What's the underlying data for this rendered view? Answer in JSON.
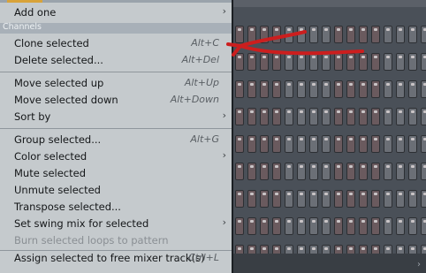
{
  "menu": {
    "add_one": "Add one",
    "channels_header": "Channels",
    "clone": {
      "label": "Clone selected",
      "shortcut": "Alt+C"
    },
    "delete": {
      "label": "Delete selected...",
      "shortcut": "Alt+Del"
    },
    "move_up": {
      "label": "Move selected up",
      "shortcut": "Alt+Up"
    },
    "move_down": {
      "label": "Move selected down",
      "shortcut": "Alt+Down"
    },
    "sort_by": "Sort by",
    "group": {
      "label": "Group selected...",
      "shortcut": "Alt+G"
    },
    "color": "Color selected",
    "mute": "Mute selected",
    "unmute": "Unmute selected",
    "transpose": "Transpose selected...",
    "swing": "Set swing mix for selected",
    "burn": "Burn selected loops to pattern",
    "assign": {
      "label": "Assign selected to free mixer track(s)",
      "shortcut": "Ctrl+L"
    },
    "submenu_arrow": "›"
  },
  "annotation": {
    "arrow_color": "#cc1e1e"
  },
  "colors": {
    "menu_bg": "#c5cacd",
    "header_bg": "#a8b0b8",
    "step_on": "#6a5a5e",
    "step_off": "#6b6f76"
  }
}
